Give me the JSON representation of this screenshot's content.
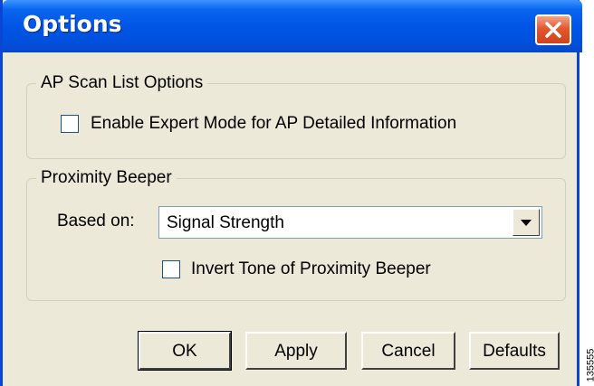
{
  "window": {
    "title": "Options"
  },
  "ap_scan": {
    "legend": "AP Scan List Options",
    "expert_mode_label": "Enable Expert Mode for AP Detailed Information",
    "expert_mode_checked": false
  },
  "beeper": {
    "legend": "Proximity Beeper",
    "based_on_label": "Based on:",
    "based_on_value": "Signal Strength",
    "invert_label": "Invert Tone of Proximity Beeper",
    "invert_checked": false
  },
  "buttons": {
    "ok": "OK",
    "apply": "Apply",
    "cancel": "Cancel",
    "defaults": "Defaults"
  },
  "figure_id": "135555"
}
